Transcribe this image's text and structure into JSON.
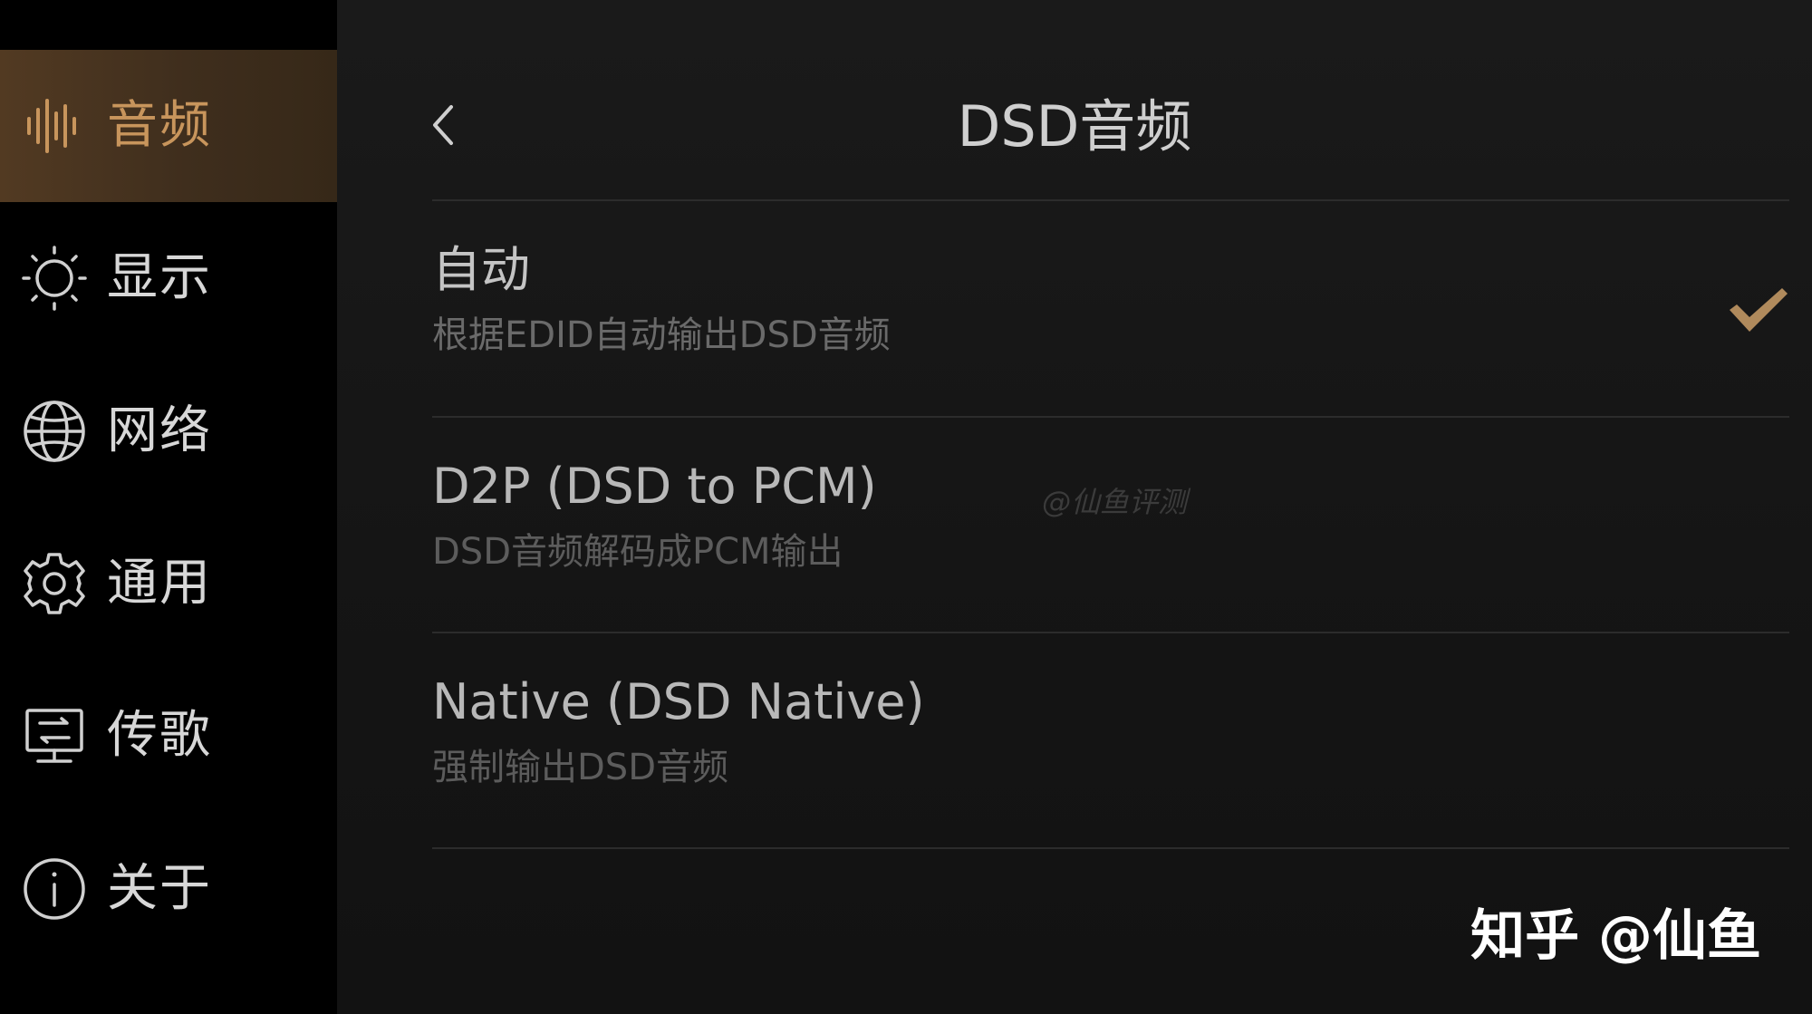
{
  "sidebar": {
    "items": [
      {
        "label": "音频",
        "icon": "audio-waveform-icon",
        "active": true
      },
      {
        "label": "显示",
        "icon": "brightness-icon",
        "active": false
      },
      {
        "label": "网络",
        "icon": "globe-icon",
        "active": false
      },
      {
        "label": "通用",
        "icon": "gear-icon",
        "active": false
      },
      {
        "label": "传歌",
        "icon": "transfer-icon",
        "active": false
      },
      {
        "label": "关于",
        "icon": "info-icon",
        "active": false
      }
    ]
  },
  "header": {
    "title": "DSD音频",
    "back_icon": "chevron-left-icon"
  },
  "options": [
    {
      "title": "自动",
      "subtitle": "根据EDID自动输出DSD音频",
      "selected": true
    },
    {
      "title": "D2P (DSD to PCM)",
      "subtitle": "DSD音频解码成PCM输出",
      "selected": false
    },
    {
      "title": "Native (DSD Native)",
      "subtitle": "强制输出DSD音频",
      "selected": false
    }
  ],
  "watermark": "@仙鱼评测",
  "brand_watermark": "知乎 @仙鱼",
  "colors": {
    "accent": "#c8955c",
    "active_bg": "#4a3520",
    "check": "#b08a5c",
    "sidebar_bg": "#000000",
    "main_bg": "#161616"
  }
}
